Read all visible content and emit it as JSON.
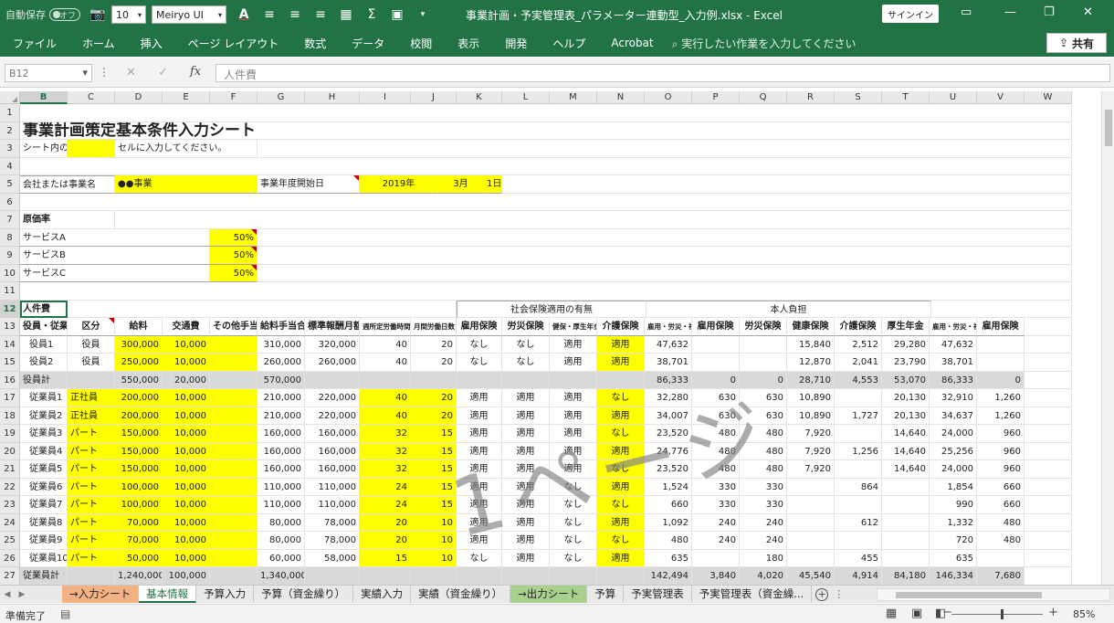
{
  "qat": {
    "autosave_label": "自動保存",
    "autosave_state": "オフ",
    "font_size": "10",
    "font_name": "Meiryo UI",
    "title": "事業計画・予実管理表_パラメーター連動型_入力例.xlsx - Excel",
    "signin": "サインイン"
  },
  "ribbon": {
    "tabs": [
      "ファイル",
      "ホーム",
      "挿入",
      "ページ レイアウト",
      "数式",
      "データ",
      "校閲",
      "表示",
      "開発",
      "ヘルプ",
      "Acrobat"
    ],
    "search": "実行したい作業を入力してください",
    "share": "共有"
  },
  "formula_bar": {
    "name_box": "B12",
    "content": "人件費"
  },
  "columns": [
    "B",
    "C",
    "D",
    "E",
    "F",
    "G",
    "H",
    "I",
    "J",
    "K",
    "L",
    "M",
    "N",
    "O",
    "P",
    "Q",
    "R",
    "S",
    "T",
    "U",
    "V",
    "W"
  ],
  "rows": {
    "r1": "1",
    "r2": "2",
    "r3": "3",
    "r4": "4",
    "r5": "5",
    "r6": "6",
    "r7": "7",
    "r8": "8",
    "r9": "9",
    "r10": "10",
    "r11": "11",
    "r12": "12",
    "r13": "13",
    "r14": "14",
    "r15": "15",
    "r16": "16",
    "r17": "17",
    "r18": "18",
    "r19": "19",
    "r20": "20",
    "r21": "21",
    "r22": "22",
    "r23": "23",
    "r24": "24",
    "r25": "25",
    "r26": "26",
    "r27": "27"
  },
  "sheet": {
    "title": "事業計画策定基本条件入力シート",
    "note_pre": "シート内の",
    "note_post": "セルに入力してください。",
    "company_label": "会社または事業名",
    "company_value": "●●事業",
    "start_label": "事業年度開始日",
    "year": "2019年",
    "month": "3月",
    "day": "1日",
    "cost_ratio_label": "原価率",
    "services": [
      {
        "name": "サービスA",
        "rate": "50%"
      },
      {
        "name": "サービスB",
        "rate": "50%"
      },
      {
        "name": "サービスC",
        "rate": "50%"
      }
    ],
    "personnel_label": "人件費",
    "social_ins_header": "社会保険適用の有無",
    "self_burden_header": "本人負担",
    "headers": [
      "役員・従業員",
      "区分",
      "給料",
      "交通費",
      "その他手当",
      "給料手当合計",
      "標準報酬月額",
      "週所定労働時間",
      "月間労働日数",
      "雇用保険",
      "労災保険",
      "健保・厚生年金",
      "介護保険",
      "雇用・労災・社保",
      "雇用保険",
      "労災保険",
      "健康保険",
      "介護保険",
      "厚生年金",
      "雇用・労災・社保",
      "雇用保険"
    ],
    "data_rows": [
      [
        "役員1",
        "役員",
        "300,000",
        "10,000",
        "",
        "310,000",
        "320,000",
        "40",
        "20",
        "なし",
        "なし",
        "適用",
        "適用",
        "47,632",
        "",
        "",
        "15,840",
        "2,512",
        "29,280",
        "47,632",
        ""
      ],
      [
        "役員2",
        "役員",
        "250,000",
        "10,000",
        "",
        "260,000",
        "260,000",
        "40",
        "20",
        "なし",
        "なし",
        "適用",
        "適用",
        "38,701",
        "",
        "",
        "12,870",
        "2,041",
        "23,790",
        "38,701",
        ""
      ],
      [
        "役員計",
        "",
        "550,000",
        "20,000",
        "",
        "570,000",
        "",
        "",
        "",
        "",
        "",
        "",
        "",
        "86,333",
        "0",
        "0",
        "28,710",
        "4,553",
        "53,070",
        "86,333",
        "0"
      ],
      [
        "従業員1",
        "正社員",
        "200,000",
        "10,000",
        "",
        "210,000",
        "220,000",
        "40",
        "20",
        "適用",
        "適用",
        "適用",
        "なし",
        "32,280",
        "630",
        "630",
        "10,890",
        "",
        "20,130",
        "32,910",
        "1,260"
      ],
      [
        "従業員2",
        "正社員",
        "200,000",
        "10,000",
        "",
        "210,000",
        "220,000",
        "40",
        "20",
        "適用",
        "適用",
        "適用",
        "適用",
        "34,007",
        "630",
        "630",
        "10,890",
        "1,727",
        "20,130",
        "34,637",
        "1,260"
      ],
      [
        "従業員3",
        "パート",
        "150,000",
        "10,000",
        "",
        "160,000",
        "160,000",
        "32",
        "15",
        "適用",
        "適用",
        "適用",
        "なし",
        "23,520",
        "480",
        "480",
        "7,920",
        "",
        "14,640",
        "24,000",
        "960"
      ],
      [
        "従業員4",
        "パート",
        "150,000",
        "10,000",
        "",
        "160,000",
        "160,000",
        "32",
        "15",
        "適用",
        "適用",
        "適用",
        "適用",
        "24,776",
        "480",
        "480",
        "7,920",
        "1,256",
        "14,640",
        "25,256",
        "960"
      ],
      [
        "従業員5",
        "パート",
        "150,000",
        "10,000",
        "",
        "160,000",
        "160,000",
        "32",
        "15",
        "適用",
        "適用",
        "適用",
        "なし",
        "23,520",
        "480",
        "480",
        "7,920",
        "",
        "14,640",
        "24,000",
        "960"
      ],
      [
        "従業員6",
        "パート",
        "100,000",
        "10,000",
        "",
        "110,000",
        "110,000",
        "24",
        "15",
        "適用",
        "適用",
        "なし",
        "適用",
        "1,524",
        "330",
        "330",
        "",
        "864",
        "",
        "1,854",
        "660"
      ],
      [
        "従業員7",
        "パート",
        "100,000",
        "10,000",
        "",
        "110,000",
        "110,000",
        "24",
        "15",
        "適用",
        "適用",
        "なし",
        "なし",
        "660",
        "330",
        "330",
        "",
        "",
        "",
        "990",
        "660"
      ],
      [
        "従業員8",
        "パート",
        "70,000",
        "10,000",
        "",
        "80,000",
        "78,000",
        "20",
        "10",
        "適用",
        "適用",
        "なし",
        "適用",
        "1,092",
        "240",
        "240",
        "",
        "612",
        "",
        "1,332",
        "480"
      ],
      [
        "従業員9",
        "パート",
        "70,000",
        "10,000",
        "",
        "80,000",
        "78,000",
        "20",
        "10",
        "適用",
        "適用",
        "なし",
        "なし",
        "480",
        "240",
        "240",
        "",
        "",
        "",
        "720",
        "480"
      ],
      [
        "従業員10",
        "パート",
        "50,000",
        "10,000",
        "",
        "60,000",
        "58,000",
        "15",
        "10",
        "なし",
        "適用",
        "なし",
        "適用",
        "635",
        "",
        "180",
        "",
        "455",
        "",
        "635",
        ""
      ],
      [
        "従業員計",
        "",
        "1,240,000",
        "100,000",
        "",
        "1,340,000",
        "",
        "",
        "",
        "",
        "",
        "",
        "",
        "142,494",
        "3,840",
        "4,020",
        "45,540",
        "4,914",
        "84,180",
        "146,334",
        "7,680"
      ]
    ],
    "watermark": "1ページ"
  },
  "sheet_tabs": [
    {
      "label": "→入力シート",
      "style": "orange"
    },
    {
      "label": "基本情報",
      "style": "active"
    },
    {
      "label": "予算入力",
      "style": ""
    },
    {
      "label": "予算（資金繰り）",
      "style": ""
    },
    {
      "label": "実績入力",
      "style": ""
    },
    {
      "label": "実績（資金繰り）",
      "style": ""
    },
    {
      "label": "→出力シート",
      "style": "green"
    },
    {
      "label": "予算",
      "style": ""
    },
    {
      "label": "予実管理表",
      "style": ""
    },
    {
      "label": "予実管理表（資金繰...",
      "style": ""
    }
  ],
  "status": {
    "ready": "準備完了",
    "zoom": "85%"
  },
  "colors": {
    "excel_green": "#217346",
    "input_yellow": "#ffff00",
    "total_gray": "#d9d9d9",
    "comment_red": "#c00000"
  }
}
